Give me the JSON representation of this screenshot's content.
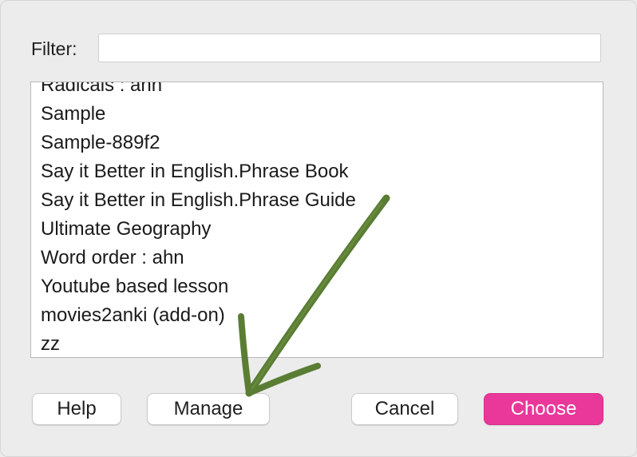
{
  "filter": {
    "label": "Filter:",
    "value": "",
    "placeholder": ""
  },
  "deck_list": {
    "items": [
      "Radicals : ahn",
      "Sample",
      "Sample-889f2",
      "Say it Better in English.Phrase Book",
      "Say it Better in English.Phrase Guide",
      "Ultimate Geography",
      "Word order : ahn",
      "Youtube based lesson",
      "movies2anki (add-on)",
      "zz"
    ]
  },
  "buttons": {
    "help": "Help",
    "manage": "Manage",
    "cancel": "Cancel",
    "choose": "Choose"
  },
  "colors": {
    "accent": "#e9389a",
    "annotation_arrow": "#5a7d34"
  },
  "annotation": {
    "icon": "hand-drawn-arrow-icon",
    "points_to": "manage-button"
  }
}
